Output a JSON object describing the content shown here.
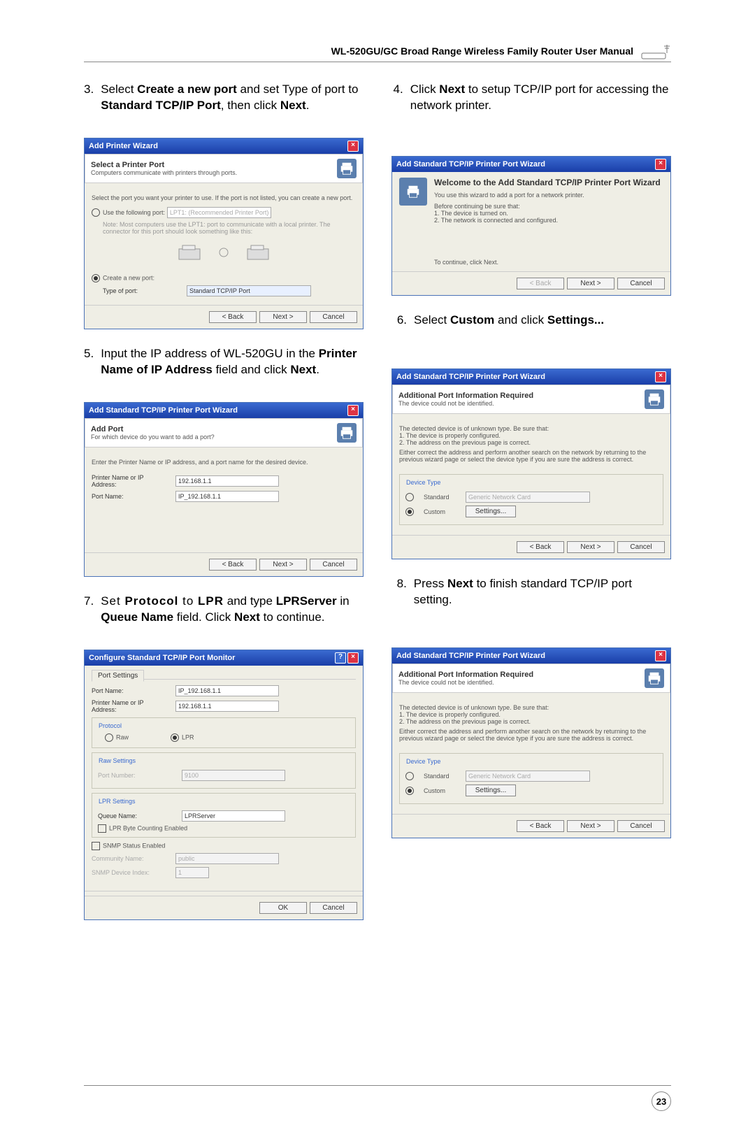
{
  "header": {
    "title": "WL-520GU/GC Broad Range Wireless Family Router User Manual"
  },
  "page_number": "23",
  "steps": {
    "s3n": "3.",
    "s3a": "Select ",
    "s3b": "Create a new port",
    "s3c": " and set Type of port to ",
    "s3d": "Standard TCP/IP Port",
    "s3e": ", then click ",
    "s3f": "Next",
    "s3g": ".",
    "s4n": "4.",
    "s4a": "Click ",
    "s4b": "Next",
    "s4c": " to setup TCP/IP port for accessing the network printer.",
    "s5n": "5.",
    "s5a": "Input the IP address of WL-520GU in the ",
    "s5b": "Printer Name of IP Address",
    "s5c": " field and click ",
    "s5d": "Next",
    "s5e": ".",
    "s6n": "6.",
    "s6a": "Select ",
    "s6b": "Custom",
    "s6c": " and click ",
    "s6d": "Settings...",
    "s7n": "7.",
    "s7a": "Set ",
    "s7b": "Protocol",
    "s7c": " to ",
    "s7d": "LPR",
    "s7e": " and type ",
    "s7f": "LPRServer",
    "s7g": " in ",
    "s7h": "Queue Name",
    "s7i": " field. Click ",
    "s7j": "Next",
    "s7k": " to continue.",
    "s8n": "8.",
    "s8a": "Press ",
    "s8b": "Next",
    "s8c": " to finish standard TCP/IP port setting."
  },
  "w3": {
    "title": "Add Printer Wizard",
    "bh": "Select a Printer Port",
    "bs": "Computers communicate with printers through ports.",
    "line": "Select the port you want your printer to use. If the port is not listed, you can create a new port.",
    "r1": "Use the following port:",
    "r1_value": "LPT1: (Recommended Printer Port)",
    "note": "Note: Most computers use the LPT1: port to communicate with a local printer. The connector for this port should look something like this:",
    "r2": "Create a new port:",
    "type_l": "Type of port:",
    "type_v": "Standard TCP/IP Port",
    "back": "< Back",
    "next": "Next >",
    "cancel": "Cancel"
  },
  "w4": {
    "title": "Add Standard TCP/IP Printer Port Wizard",
    "h1": "Welcome to the Add Standard TCP/IP Printer Port Wizard",
    "p1": "You use this wizard to add a port for a network printer.",
    "p2": "Before continuing be sure that:",
    "l1": "1. The device is turned on.",
    "l2": "2. The network is connected and configured.",
    "p3": "To continue, click Next.",
    "back": "< Back",
    "next": "Next >",
    "cancel": "Cancel"
  },
  "w5": {
    "title": "Add Standard TCP/IP Printer Port Wizard",
    "bh": "Add Port",
    "bs": "For which device do you want to add a port?",
    "line": "Enter the Printer Name or IP address, and a port name for the desired device.",
    "f1l": "Printer Name or IP Address:",
    "f1v": "192.168.1.1",
    "f2l": "Port Name:",
    "f2v": "IP_192.168.1.1",
    "back": "< Back",
    "next": "Next >",
    "cancel": "Cancel"
  },
  "w68": {
    "title": "Add Standard TCP/IP Printer Port Wizard",
    "bh": "Additional Port Information Required",
    "bs": "The device could not be identified.",
    "p1": "The detected device is of unknown type. Be sure that:",
    "l1": "1. The device is properly configured.",
    "l2": "2. The address on the previous page is correct.",
    "p2": "Either correct the address and perform another search on the network by returning to the previous wizard page or select the device type if you are sure the address is correct.",
    "dt": "Device Type",
    "std_l": "Standard",
    "std_v": "Generic Network Card",
    "cus_l": "Custom",
    "cus_b": "Settings...",
    "back": "< Back",
    "next": "Next >",
    "cancel": "Cancel"
  },
  "w7": {
    "title": "Configure Standard TCP/IP Port Monitor",
    "tab": "Port Settings",
    "f1l": "Port Name:",
    "f1v": "IP_192.168.1.1",
    "f2l": "Printer Name or IP Address:",
    "f2v": "192.168.1.1",
    "g1": "Protocol",
    "raw": "Raw",
    "lpr": "LPR",
    "g2": "Raw Settings",
    "raw_pn": "Port Number:",
    "raw_pv": "9100",
    "g3": "LPR Settings",
    "qn_l": "Queue Name:",
    "qn_v": "LPRServer",
    "lbc": "LPR Byte Counting Enabled",
    "snmp": "SNMP Status Enabled",
    "cn_l": "Community Name:",
    "cn_v": "public",
    "di_l": "SNMP Device Index:",
    "di_v": "1",
    "ok": "OK",
    "cancel": "Cancel"
  }
}
